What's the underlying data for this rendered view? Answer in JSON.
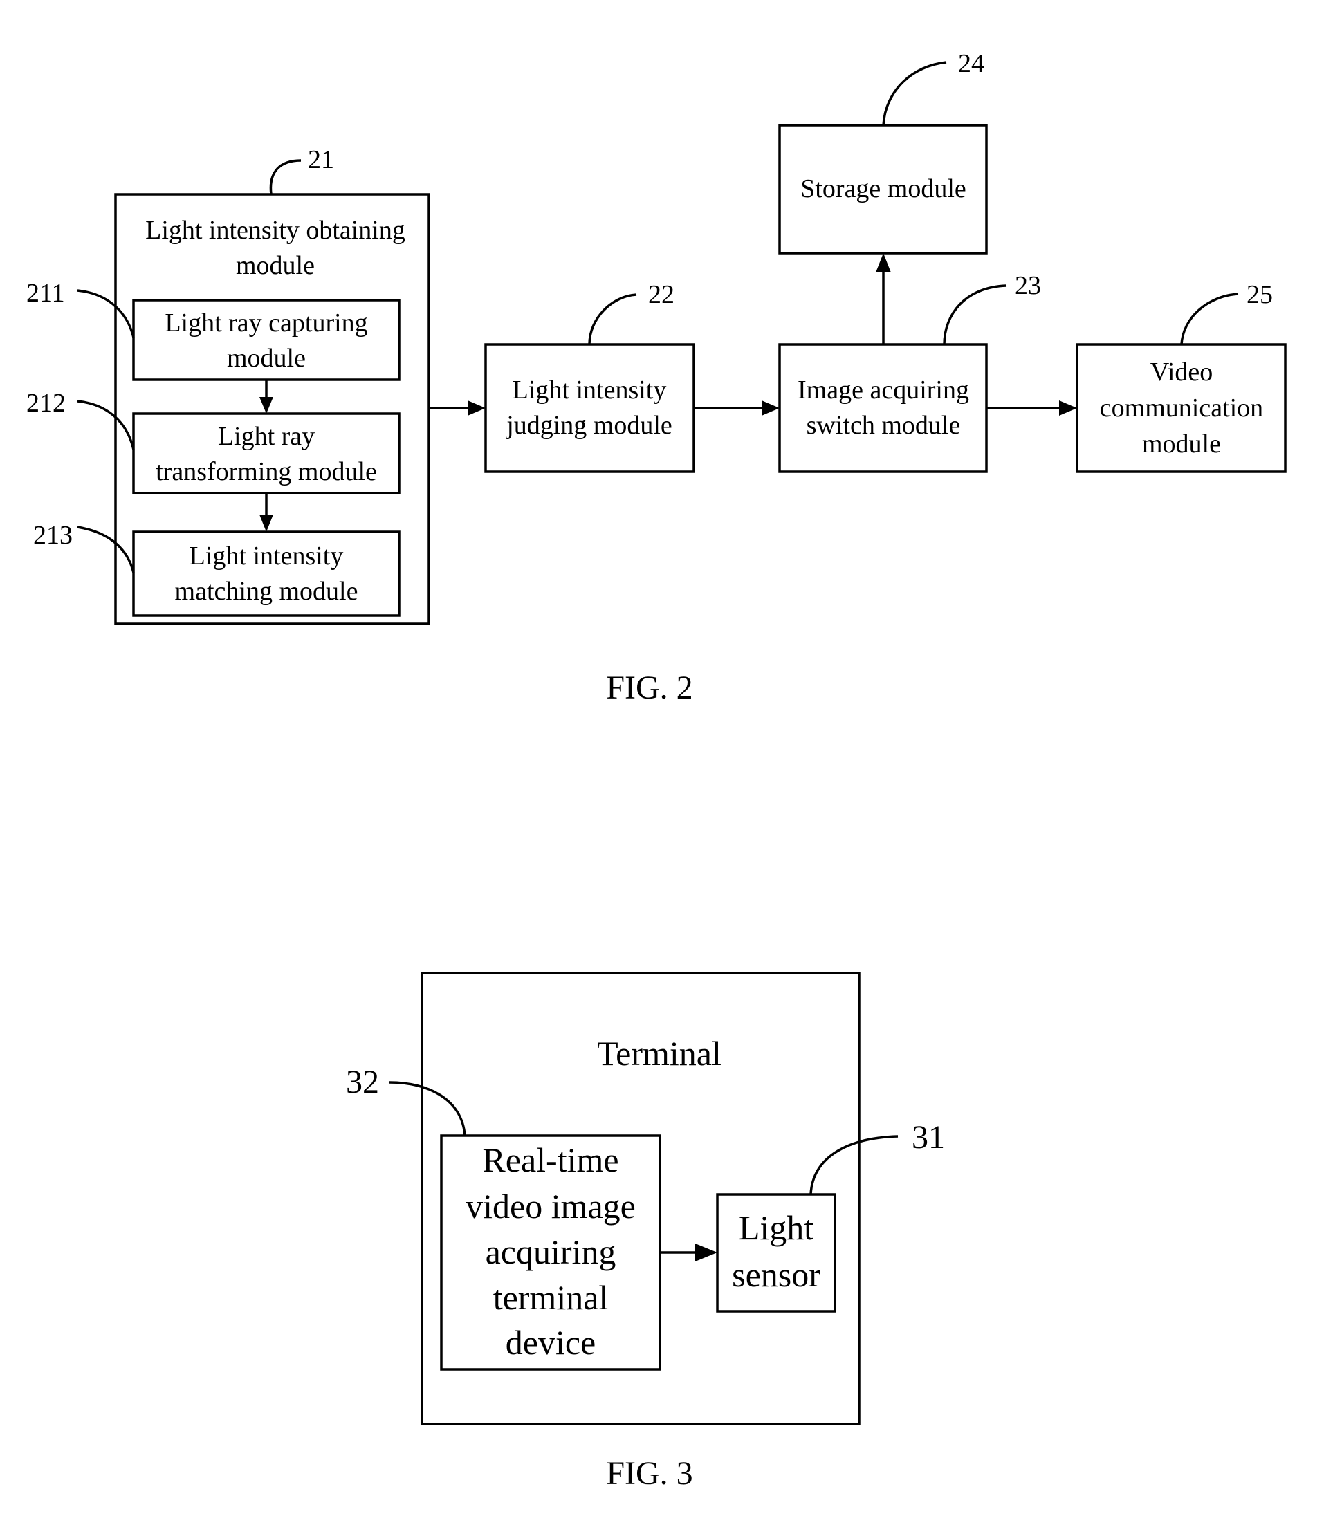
{
  "fig2": {
    "caption": "FIG. 2",
    "modules": {
      "m21": {
        "ref": "21",
        "lines": [
          "Light intensity obtaining",
          "module"
        ]
      },
      "m211": {
        "ref": "211",
        "lines": [
          "Light ray capturing",
          "module"
        ]
      },
      "m212": {
        "ref": "212",
        "lines": [
          "Light ray",
          "transforming module"
        ]
      },
      "m213": {
        "ref": "213",
        "lines": [
          "Light intensity",
          "matching module"
        ]
      },
      "m22": {
        "ref": "22",
        "lines": [
          "Light intensity",
          "judging module"
        ]
      },
      "m23": {
        "ref": "23",
        "lines": [
          "Image acquiring",
          "switch module"
        ]
      },
      "m24": {
        "ref": "24",
        "lines": [
          "Storage module"
        ]
      },
      "m25": {
        "ref": "25",
        "lines": [
          "Video",
          "communication",
          "module"
        ]
      }
    },
    "connections": [
      {
        "from": "211",
        "to": "212"
      },
      {
        "from": "212",
        "to": "213"
      },
      {
        "from": "21",
        "to": "22"
      },
      {
        "from": "22",
        "to": "23"
      },
      {
        "from": "23",
        "to": "24"
      },
      {
        "from": "23",
        "to": "25"
      }
    ]
  },
  "fig3": {
    "caption": "FIG. 3",
    "terminal": {
      "lines": [
        "Terminal"
      ]
    },
    "modules": {
      "m32": {
        "ref": "32",
        "lines": [
          "Real-time",
          "video image",
          "acquiring",
          "terminal",
          "device"
        ]
      },
      "m31": {
        "ref": "31",
        "lines": [
          "Light",
          "sensor"
        ]
      }
    },
    "connections": [
      {
        "from": "32",
        "to": "31"
      }
    ]
  }
}
